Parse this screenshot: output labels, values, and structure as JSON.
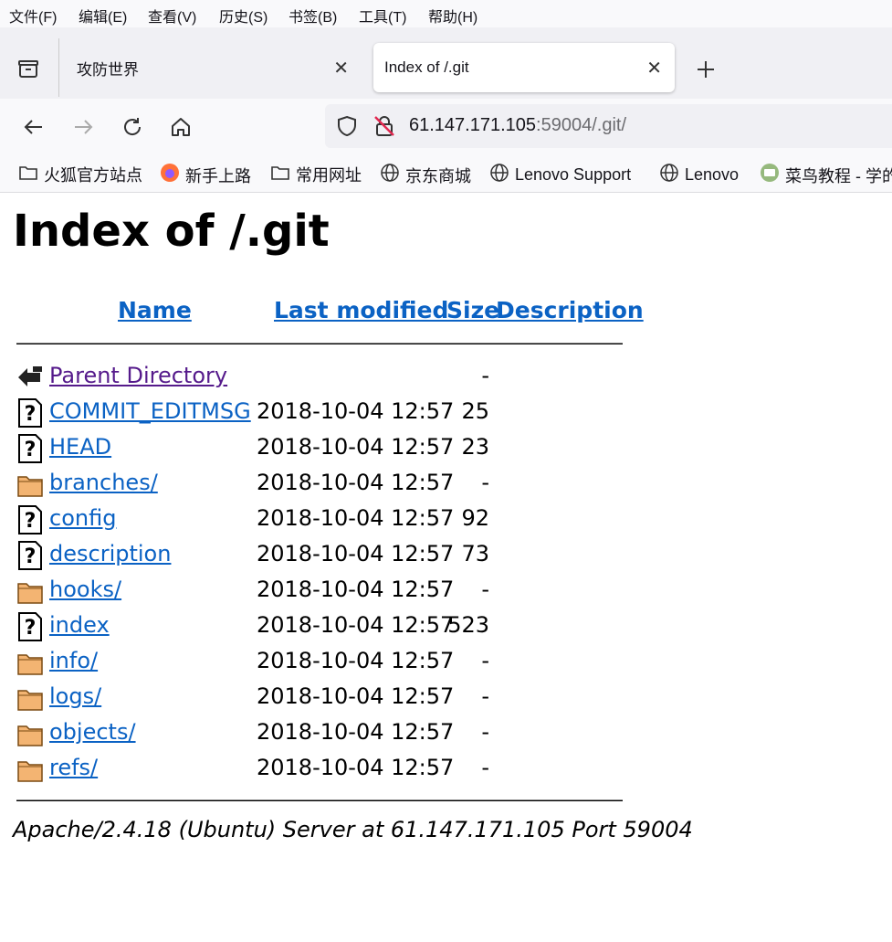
{
  "menubar": {
    "items": [
      "文件(F)",
      "编辑(E)",
      "查看(V)",
      "历史(S)",
      "书签(B)",
      "工具(T)",
      "帮助(H)"
    ]
  },
  "tabs": [
    {
      "title": "攻防世界",
      "active": false
    },
    {
      "title": "Index of /.git",
      "active": true
    }
  ],
  "url": {
    "host": "61.147.171.105",
    "rest": ":59004/.git/"
  },
  "bookmarks": [
    "火狐官方站点",
    "新手上路",
    "常用网址",
    "京东商城",
    "Lenovo Support",
    "Lenovo",
    "菜鸟教程 - 学的"
  ],
  "page": {
    "title": "Index of /.git",
    "columns": {
      "name": "Name",
      "modified": "Last modified",
      "size": "Size",
      "description": "Description"
    },
    "entries": [
      {
        "name": "Parent Directory",
        "modified": "",
        "size": "-",
        "type": "back"
      },
      {
        "name": "COMMIT_EDITMSG",
        "modified": "2018-10-04 12:57",
        "size": "25",
        "type": "file"
      },
      {
        "name": "HEAD",
        "modified": "2018-10-04 12:57",
        "size": "23",
        "type": "file"
      },
      {
        "name": "branches/",
        "modified": "2018-10-04 12:57",
        "size": "-",
        "type": "folder"
      },
      {
        "name": "config",
        "modified": "2018-10-04 12:57",
        "size": "92",
        "type": "file"
      },
      {
        "name": "description",
        "modified": "2018-10-04 12:57",
        "size": "73",
        "type": "file"
      },
      {
        "name": "hooks/",
        "modified": "2018-10-04 12:57",
        "size": "-",
        "type": "folder"
      },
      {
        "name": "index",
        "modified": "2018-10-04 12:57",
        "size": "523",
        "type": "file"
      },
      {
        "name": "info/",
        "modified": "2018-10-04 12:57",
        "size": "-",
        "type": "folder"
      },
      {
        "name": "logs/",
        "modified": "2018-10-04 12:57",
        "size": "-",
        "type": "folder"
      },
      {
        "name": "objects/",
        "modified": "2018-10-04 12:57",
        "size": "-",
        "type": "folder"
      },
      {
        "name": "refs/",
        "modified": "2018-10-04 12:57",
        "size": "-",
        "type": "folder"
      }
    ],
    "footer": "Apache/2.4.18 (Ubuntu) Server at 61.147.171.105 Port 59004"
  }
}
